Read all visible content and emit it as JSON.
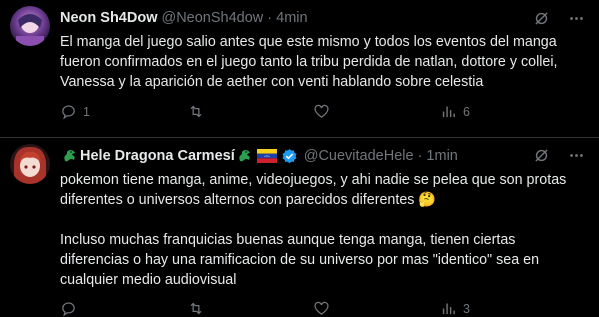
{
  "tweets": [
    {
      "name": "Neon Sh4Dow",
      "handle": "@NeonSh4dow",
      "separator": "·",
      "time": "4min",
      "text": "El manga del juego salio antes que este mismo y todos los eventos del manga fueron confirmados en el juego tanto la tribu perdida de natlan, dottore y collei, Vanessa y la aparición de aether con venti hablando sobre celestia",
      "actions": {
        "reply": "1",
        "retweet": "",
        "like": "",
        "views": "6"
      }
    },
    {
      "name": "Hele Dragona Carmesí",
      "handle": "@CuevitadeHele",
      "separator": "·",
      "time": "1min",
      "text": "pokemon tiene manga, anime, videojuegos, y ahi nadie se pelea que son protas diferentes o universos alternos con parecidos diferentes 🤔\n\nIncluso muchas franquicias buenas aunque tenga manga, tienen ciertas diferencias o hay una ramificacion de su universo por mas \"identico\" sea en cualquier medio audiovisual",
      "actions": {
        "reply": "",
        "retweet": "",
        "like": "",
        "views": "3"
      }
    }
  ],
  "icons": [
    "grok-icon",
    "more-icon",
    "reply-icon",
    "retweet-icon",
    "like-icon",
    "views-icon",
    "dragon-emoji-icon",
    "venezuela-flag-icon",
    "verified-badge-icon"
  ],
  "colors": {
    "background": "#000000",
    "text": "#e7e9ea",
    "muted": "#71767b",
    "verified": "#1d9bf0",
    "divider": "#2f3336"
  }
}
